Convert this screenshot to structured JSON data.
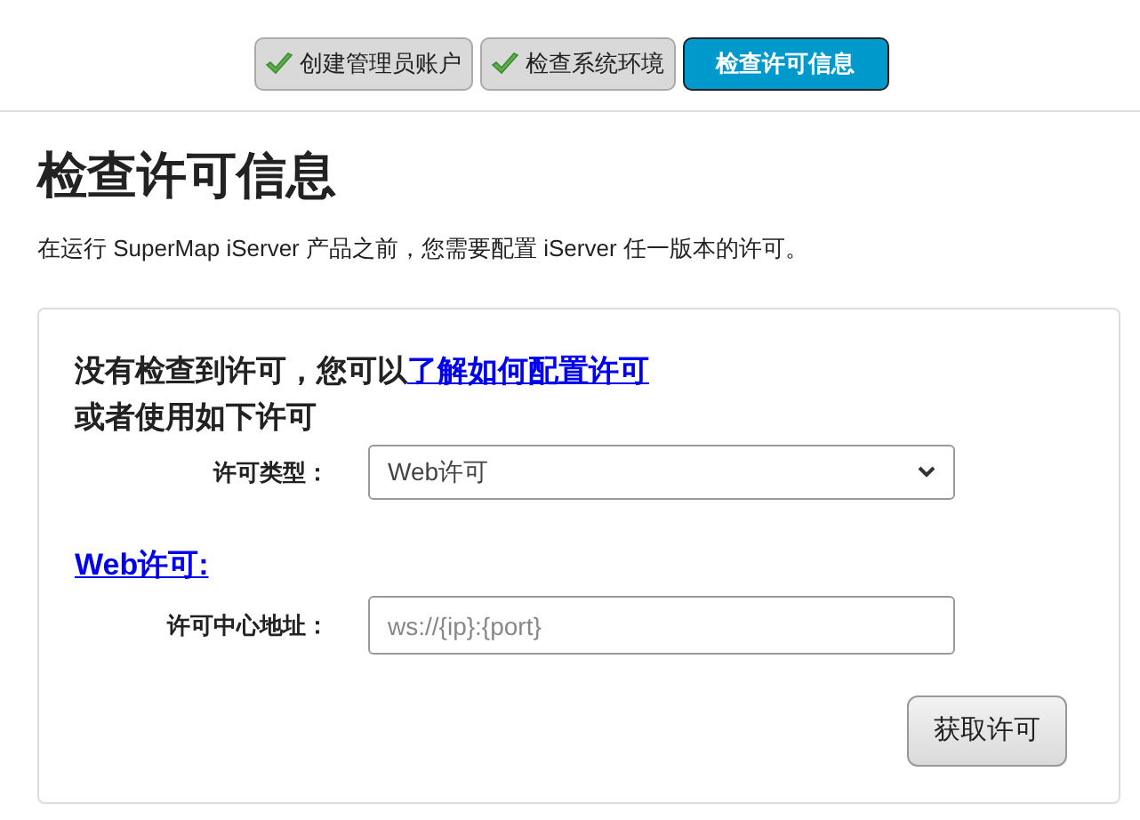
{
  "steps": [
    {
      "label": "创建管理员账户",
      "done": true,
      "selected": false
    },
    {
      "label": "检查系统环境",
      "done": true,
      "selected": false
    },
    {
      "label": "检查许可信息",
      "done": false,
      "selected": true
    }
  ],
  "heading": "检查许可信息",
  "description": "在运行 SuperMap iServer 产品之前，您需要配置 iServer 任一版本的许可。",
  "card": {
    "notice": "没有检查到许可，您可以",
    "notice_link": "了解如何配置许可",
    "notice_line2": "或者使用如下许可",
    "license_type": {
      "label": "许可类型：",
      "value": "Web许可"
    },
    "section_link": "Web许可:",
    "center_address": {
      "label": "许可中心地址：",
      "placeholder": "ws://{ip}:{port}"
    },
    "button": "获取许可"
  }
}
